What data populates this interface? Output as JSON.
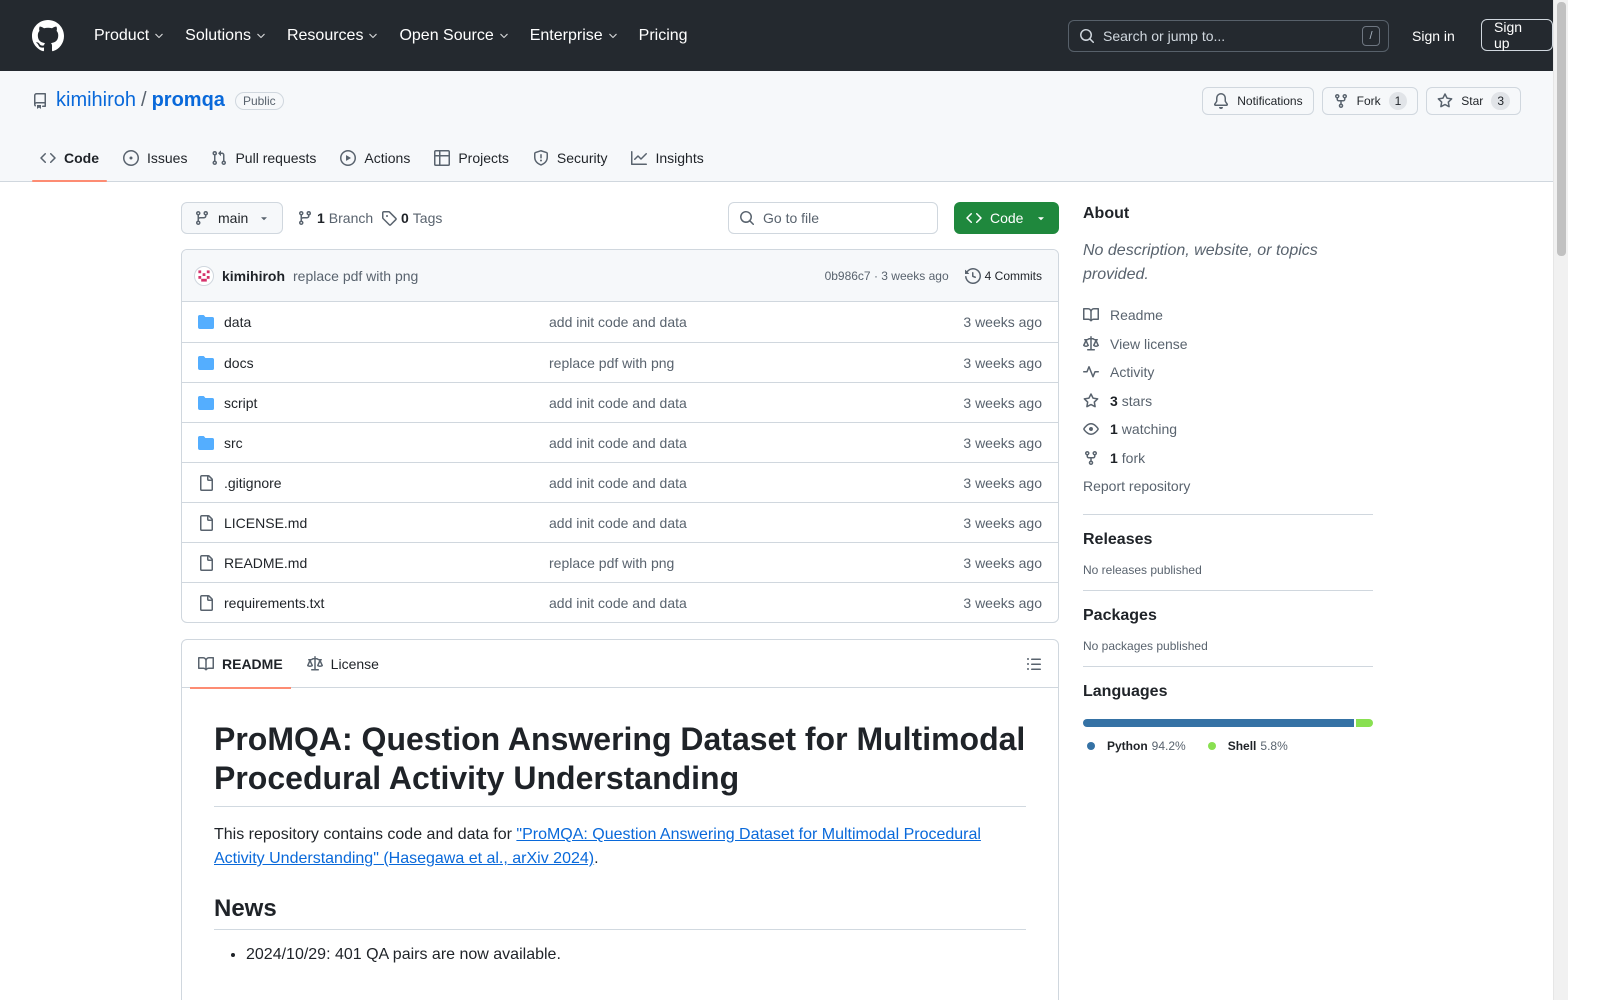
{
  "header": {
    "nav": [
      "Product",
      "Solutions",
      "Resources",
      "Open Source",
      "Enterprise",
      "Pricing"
    ],
    "search_placeholder": "Search or jump to...",
    "search_key": "/",
    "signin": "Sign in",
    "signup": "Sign up"
  },
  "repo": {
    "owner": "kimihiroh",
    "sep": "/",
    "name": "promqa",
    "visibility": "Public",
    "notifications": "Notifications",
    "fork_label": "Fork",
    "fork_count": "1",
    "star_label": "Star",
    "star_count": "3",
    "tabs": [
      "Code",
      "Issues",
      "Pull requests",
      "Actions",
      "Projects",
      "Security",
      "Insights"
    ]
  },
  "filenav": {
    "branch": "main",
    "branch_count": "1",
    "branch_label": "Branch",
    "tag_count": "0",
    "tag_label": "Tags",
    "goto_placeholder": "Go to file",
    "code_button": "Code"
  },
  "commit": {
    "author": "kimihiroh",
    "message": "replace pdf with png",
    "sha_time": "0b986c7 · 3 weeks ago",
    "count": "4 Commits"
  },
  "files": [
    {
      "name": "data",
      "type": "dir",
      "message": "add init code and data",
      "time": "3 weeks ago"
    },
    {
      "name": "docs",
      "type": "dir",
      "message": "replace pdf with png",
      "time": "3 weeks ago"
    },
    {
      "name": "script",
      "type": "dir",
      "message": "add init code and data",
      "time": "3 weeks ago"
    },
    {
      "name": "src",
      "type": "dir",
      "message": "add init code and data",
      "time": "3 weeks ago"
    },
    {
      "name": ".gitignore",
      "type": "file",
      "message": "add init code and data",
      "time": "3 weeks ago"
    },
    {
      "name": "LICENSE.md",
      "type": "file",
      "message": "add init code and data",
      "time": "3 weeks ago"
    },
    {
      "name": "README.md",
      "type": "file",
      "message": "replace pdf with png",
      "time": "3 weeks ago"
    },
    {
      "name": "requirements.txt",
      "type": "file",
      "message": "add init code and data",
      "time": "3 weeks ago"
    }
  ],
  "readme": {
    "tab_readme": "README",
    "tab_license": "License",
    "title": "ProMQA: Question Answering Dataset for Multimodal Procedural Activity Understanding",
    "intro_prefix": "This repository contains code and data for ",
    "intro_link": "\"ProMQA: Question Answering Dataset for Multimodal Procedural Activity Understanding\" (Hasegawa et al., arXiv 2024)",
    "intro_suffix": ".",
    "news_heading": "News",
    "news": [
      "2024/10/29: 401 QA pairs are now available."
    ]
  },
  "sidebar": {
    "about_heading": "About",
    "about_desc": "No description, website, or topics provided.",
    "readme": "Readme",
    "license": "View license",
    "activity": "Activity",
    "stars_count": "3",
    "stars_label": "stars",
    "watching_count": "1",
    "watching_label": "watching",
    "forks_count": "1",
    "forks_label": "fork",
    "report": "Report repository",
    "releases_heading": "Releases",
    "releases_text": "No releases published",
    "packages_heading": "Packages",
    "packages_text": "No packages published",
    "languages_heading": "Languages",
    "languages": [
      {
        "name": "Python",
        "percent": "94.2%",
        "value": 94.2,
        "color": "#3572A5"
      },
      {
        "name": "Shell",
        "percent": "5.8%",
        "value": 5.8,
        "color": "#89e051"
      }
    ]
  },
  "colors": {
    "accent": "#0969da",
    "header_bg": "#24292f",
    "code_button": "#1f883d",
    "folder_icon": "#54aeff",
    "tab_underline": "#fd8c73"
  }
}
